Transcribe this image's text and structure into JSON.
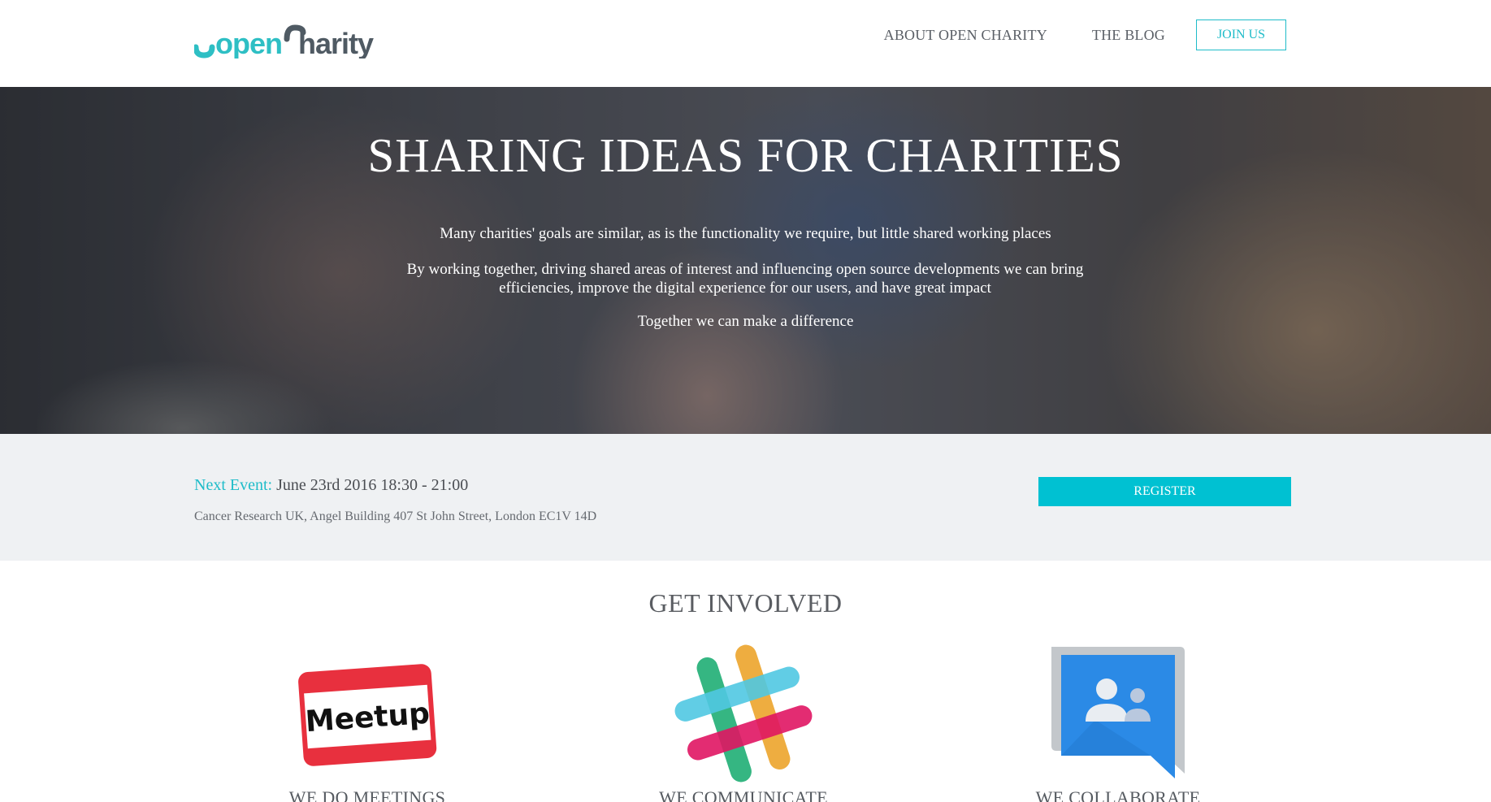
{
  "header": {
    "logo": {
      "part1": "open",
      "part2": "harity",
      "alt": "openCharity"
    },
    "nav": {
      "about": "ABOUT OPEN CHARITY",
      "blog": "THE BLOG",
      "join": "JOIN US"
    }
  },
  "hero": {
    "title": "SHARING IDEAS FOR CHARITIES",
    "paragraph1": "Many charities' goals are similar, as is the functionality we require, but little shared working places",
    "paragraph2": "By working together, driving shared areas of interest and influencing open source developments we can bring efficiencies, improve the digital experience for our users, and have great impact",
    "paragraph3": "Together we can make a difference"
  },
  "event": {
    "label": "Next Event:",
    "datetime": "June 23rd 2016 18:30 - 21:00",
    "address": "Cancer Research UK, Angel Building 407 St John Street, London EC1V 14D",
    "register": "REGISTER"
  },
  "involved": {
    "title": "GET INVOLVED",
    "cards": [
      {
        "icon": "meetup-icon",
        "caption": "WE DO MEETINGS",
        "badge_text": "Meetup"
      },
      {
        "icon": "slack-icon",
        "caption": "WE COMMUNICATE"
      },
      {
        "icon": "google-groups-icon",
        "caption": "WE COLLABORATE"
      }
    ]
  },
  "colors": {
    "accent": "#1fbcc9",
    "register": "#00c1d2",
    "event_band": "#eff1f3",
    "text": "#555555"
  }
}
